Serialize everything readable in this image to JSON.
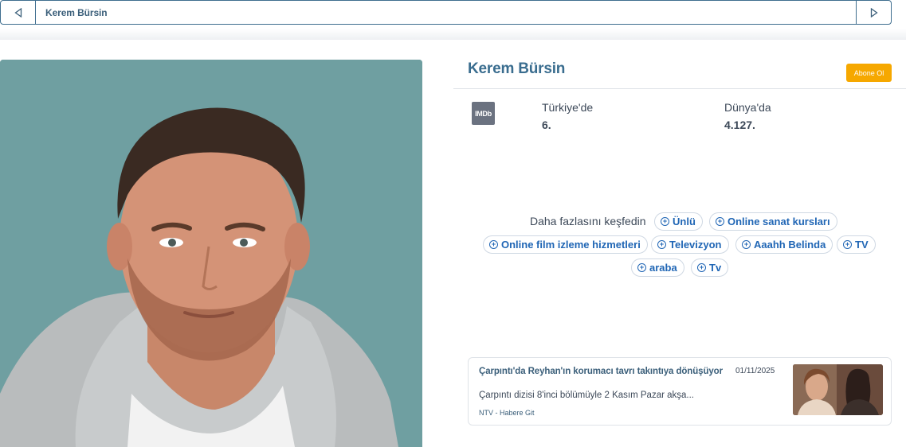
{
  "nav": {
    "title": "Kerem Bürsin",
    "prev_icon": "triangle-left-icon",
    "next_icon": "triangle-right-icon"
  },
  "profile": {
    "name": "Kerem Bürsin",
    "subscribe_label": "Abone Ol",
    "photo_alt": "portrait-photo"
  },
  "ranking": {
    "source_logo": "IMDb",
    "turkey_label": "Türkiye'de",
    "turkey_value": "6.",
    "world_label": "Dünya'da",
    "world_value": "4.127."
  },
  "explore": {
    "label": "Daha fazlasını keşfedin",
    "chips": [
      "Ünlü",
      "Online sanat kursları",
      "Online film izleme hizmetleri",
      "Televizyon",
      "Aaahh Belinda",
      "TV",
      "araba",
      "Tv"
    ],
    "chip_icon": "plus-circle-icon"
  },
  "news": {
    "title": "Çarpıntı'da Reyhan'ın korumacı tavrı takıntıya dönüşüyor",
    "date": "01/11/2025",
    "description": "Çarpıntı dizisi 8'inci bölümüyle 2 Kasım Pazar akşa...",
    "source": "NTV - Habere Git"
  },
  "colors": {
    "accent": "#3a6d8f",
    "link": "#2066b5",
    "subscribe": "#f6a800",
    "photo_bg": "#6e9ea0"
  }
}
